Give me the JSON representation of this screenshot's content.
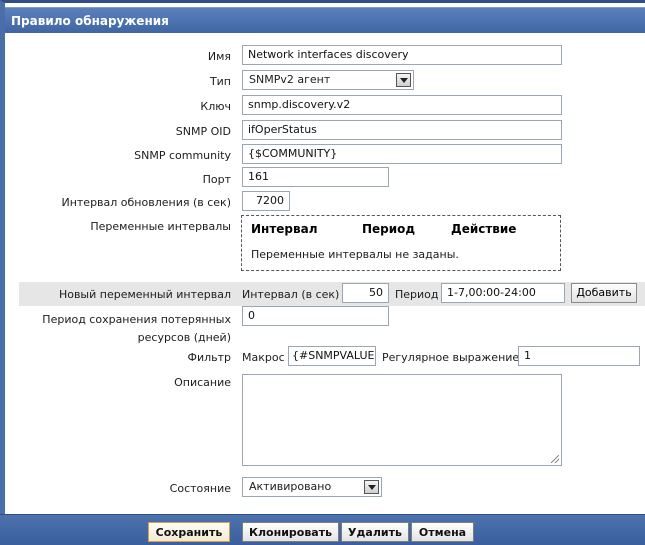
{
  "title": "Правило обнаружения",
  "form": {
    "name": {
      "label": "Имя",
      "value": "Network interfaces discovery"
    },
    "type": {
      "label": "Тип",
      "value": "SNMPv2 агент"
    },
    "key": {
      "label": "Ключ",
      "value": "snmp.discovery.v2"
    },
    "snmp_oid": {
      "label": "SNMP OID",
      "value": "ifOperStatus"
    },
    "snmp_community": {
      "label": "SNMP community",
      "value": "{$COMMUNITY}"
    },
    "port": {
      "label": "Порт",
      "value": "161"
    },
    "interval": {
      "label": "Интервал обновления (в сек)",
      "value": "7200"
    },
    "flex_intervals": {
      "label": "Переменные интервалы",
      "columns": [
        "Интервал",
        "Период",
        "Действие"
      ],
      "empty_text": "Переменные интервалы не заданы."
    },
    "new_flex": {
      "label": "Новый переменный интервал",
      "interval_label": "Интервал (в сек)",
      "interval_value": "50",
      "period_label": "Период",
      "period_value": "1-7,00:00-24:00",
      "add_button": "Добавить"
    },
    "lifetime": {
      "label_line1": "Период сохранения потерянных",
      "label_line2": "ресурсов (дней)",
      "value": "0"
    },
    "filter": {
      "label": "Фильтр",
      "macro_label": "Макрос",
      "macro_value": "{#SNMPVALUE}",
      "regex_label": "Регулярное выражение",
      "regex_value": "1"
    },
    "description": {
      "label": "Описание",
      "value": ""
    },
    "status": {
      "label": "Состояние",
      "value": "Активировано"
    }
  },
  "footer": {
    "save": "Сохранить",
    "clone": "Клонировать",
    "delete": "Удалить",
    "cancel": "Отмена"
  },
  "icons": {
    "dropdown": "chevron-down-icon",
    "resize": "resize-grip-icon"
  }
}
